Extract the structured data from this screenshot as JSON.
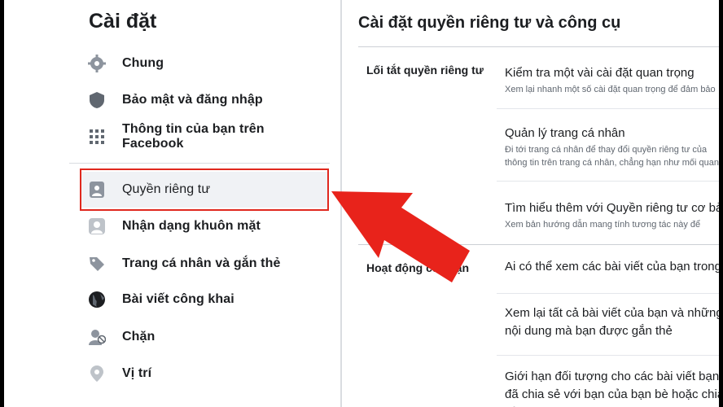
{
  "sidebar": {
    "title": "Cài đặt",
    "items": [
      {
        "label": "Chung",
        "icon": "gear-icon"
      },
      {
        "label": "Bảo mật và đăng nhập",
        "icon": "shield-icon"
      },
      {
        "label": "Thông tin của bạn trên Facebook",
        "icon": "facebook-info-icon"
      },
      {
        "label": "Quyền riêng tư",
        "icon": "lock-person-icon"
      },
      {
        "label": "Nhận dạng khuôn mặt",
        "icon": "face-recognition-icon"
      },
      {
        "label": "Trang cá nhân và gắn thẻ",
        "icon": "tag-icon"
      },
      {
        "label": "Bài viết công khai",
        "icon": "globe-icon"
      },
      {
        "label": "Chặn",
        "icon": "block-user-icon"
      },
      {
        "label": "Vị trí",
        "icon": "location-pin-icon"
      }
    ]
  },
  "main": {
    "title": "Cài đặt quyền riêng tư và công cụ",
    "sections": [
      {
        "label": "Lối tắt quyền riêng tư",
        "rows": [
          {
            "title": "Kiểm tra một vài cài đặt quan trọng",
            "desc": "Xem lại nhanh một số cài đặt quan trọng để đảm bảo"
          },
          {
            "title": "Quản lý trang cá nhân",
            "desc": "Đi tới trang cá nhân để thay đổi quyền riêng tư của thông tin trên trang cá nhân, chẳng hạn như mối quan hệ của bạn."
          },
          {
            "title": "Tìm hiểu thêm với Quyền riêng tư cơ bản",
            "desc": "Xem bản hướng dẫn mang tính tương tác này để"
          }
        ]
      },
      {
        "label": "Hoạt động của bạn",
        "rows": [
          {
            "title": "Ai có thể xem các bài viết của bạn trong tương lai?"
          },
          {
            "title": "Xem lại tất cả bài viết của bạn và những nội dung mà bạn được gắn thẻ"
          },
          {
            "title": "Giới hạn đối tượng cho các bài viết bạn đã chia sẻ với bạn của bạn bè hoặc chia sẻ công khai?"
          }
        ]
      }
    ]
  },
  "colors": {
    "highlight": "#e0281e",
    "arrow": "#e8231b"
  }
}
